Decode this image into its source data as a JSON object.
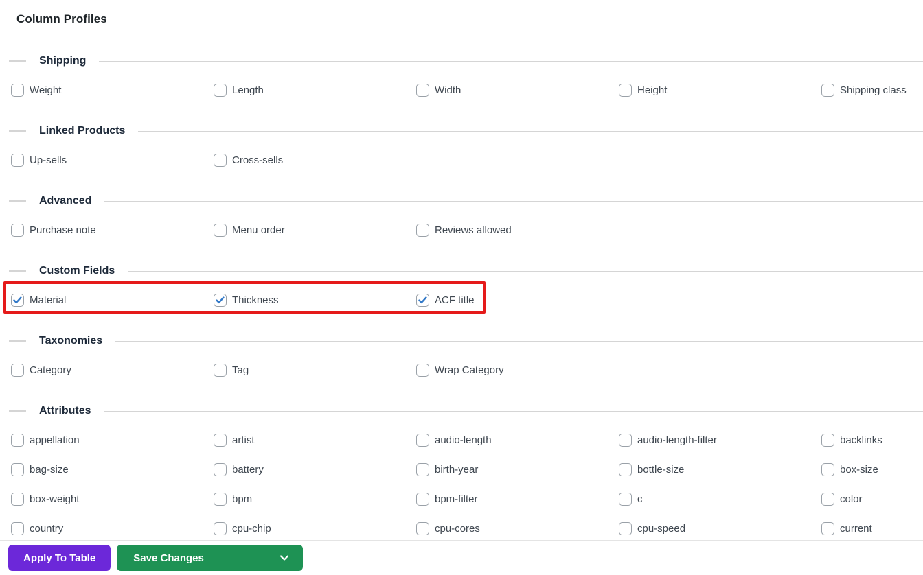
{
  "header": {
    "title": "Column Profiles"
  },
  "sections": [
    {
      "title": "Shipping",
      "items": [
        {
          "label": "Weight",
          "checked": false
        },
        {
          "label": "Length",
          "checked": false
        },
        {
          "label": "Width",
          "checked": false
        },
        {
          "label": "Height",
          "checked": false
        },
        {
          "label": "Shipping class",
          "checked": false
        }
      ]
    },
    {
      "title": "Linked Products",
      "items": [
        {
          "label": "Up-sells",
          "checked": false
        },
        {
          "label": "Cross-sells",
          "checked": false
        }
      ]
    },
    {
      "title": "Advanced",
      "items": [
        {
          "label": "Purchase note",
          "checked": false
        },
        {
          "label": "Menu order",
          "checked": false
        },
        {
          "label": "Reviews allowed",
          "checked": false
        }
      ]
    },
    {
      "title": "Custom Fields",
      "highlighted": true,
      "items": [
        {
          "label": "Material",
          "checked": true
        },
        {
          "label": "Thickness",
          "checked": true
        },
        {
          "label": "ACF title",
          "checked": true
        }
      ]
    },
    {
      "title": "Taxonomies",
      "items": [
        {
          "label": "Category",
          "checked": false
        },
        {
          "label": "Tag",
          "checked": false
        },
        {
          "label": "Wrap Category",
          "checked": false
        }
      ]
    },
    {
      "title": "Attributes",
      "items": [
        {
          "label": "appellation",
          "checked": false
        },
        {
          "label": "artist",
          "checked": false
        },
        {
          "label": "audio-length",
          "checked": false
        },
        {
          "label": "audio-length-filter",
          "checked": false
        },
        {
          "label": "backlinks",
          "checked": false
        },
        {
          "label": "bag-size",
          "checked": false
        },
        {
          "label": "battery",
          "checked": false
        },
        {
          "label": "birth-year",
          "checked": false
        },
        {
          "label": "bottle-size",
          "checked": false
        },
        {
          "label": "box-size",
          "checked": false
        },
        {
          "label": "box-weight",
          "checked": false
        },
        {
          "label": "bpm",
          "checked": false
        },
        {
          "label": "bpm-filter",
          "checked": false
        },
        {
          "label": "c",
          "checked": false
        },
        {
          "label": "color",
          "checked": false
        },
        {
          "label": "country",
          "checked": false
        },
        {
          "label": "cpu-chip",
          "checked": false
        },
        {
          "label": "cpu-cores",
          "checked": false
        },
        {
          "label": "cpu-speed",
          "checked": false
        },
        {
          "label": "current",
          "checked": false
        }
      ]
    }
  ],
  "footer": {
    "apply_label": "Apply To Table",
    "save_label": "Save Changes",
    "save_menu_icon": "chevron-down"
  },
  "colors": {
    "apply_button": "#6c28d9",
    "save_button": "#1e9254",
    "check_blue": "#3279c8",
    "highlight_red": "#e51a1a",
    "heading_text": "#1e2a3a",
    "label_text": "#3f4750",
    "rule_gray": "#d5d5d5"
  }
}
